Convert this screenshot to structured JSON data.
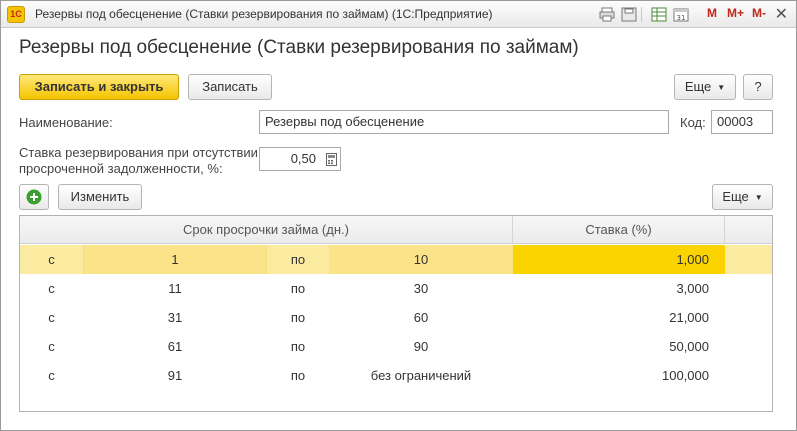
{
  "window": {
    "title": "Резервы под обесценение (Ставки резервирования по займам)  (1С:Предприятие)",
    "logo_text": "1С",
    "toolbar": {
      "m_label": "M",
      "mplus_label": "M+",
      "mminus_label": "M-",
      "close_glyph": "✕"
    }
  },
  "form": {
    "title": "Резервы под обесценение (Ставки резервирования по займам)",
    "buttons": {
      "save_close": "Записать и закрыть",
      "save": "Записать",
      "more": "Еще",
      "help": "?"
    },
    "fields": {
      "name_label": "Наименование:",
      "name_value": "Резервы под обесценение",
      "code_label": "Код:",
      "code_value": "00003",
      "rate_label_line1": "Ставка резервирования при отсутствии",
      "rate_label_line2": "просроченной задолженности, %:",
      "rate_value": "0,50"
    },
    "table_toolbar": {
      "edit": "Изменить",
      "more": "Еще"
    },
    "table": {
      "headers": {
        "term": "Срок просрочки займа (дн.)",
        "rate": "Ставка (%)"
      },
      "rows": [
        {
          "from_prefix": "с",
          "from": "1",
          "to_prefix": "по",
          "to": "10",
          "rate": "1,000"
        },
        {
          "from_prefix": "с",
          "from": "11",
          "to_prefix": "по",
          "to": "30",
          "rate": "3,000"
        },
        {
          "from_prefix": "с",
          "from": "31",
          "to_prefix": "по",
          "to": "60",
          "rate": "21,000"
        },
        {
          "from_prefix": "с",
          "from": "61",
          "to_prefix": "по",
          "to": "90",
          "rate": "50,000"
        },
        {
          "from_prefix": "с",
          "from": "91",
          "to_prefix": "по",
          "to": "без ограничений",
          "rate": "100,000"
        }
      ],
      "selected_row": 0
    }
  },
  "colors": {
    "accent": "#f5c400",
    "selected_row": "#fbeba0",
    "selected_cell": "#fbd400",
    "add_icon": "#3a9f2f"
  }
}
